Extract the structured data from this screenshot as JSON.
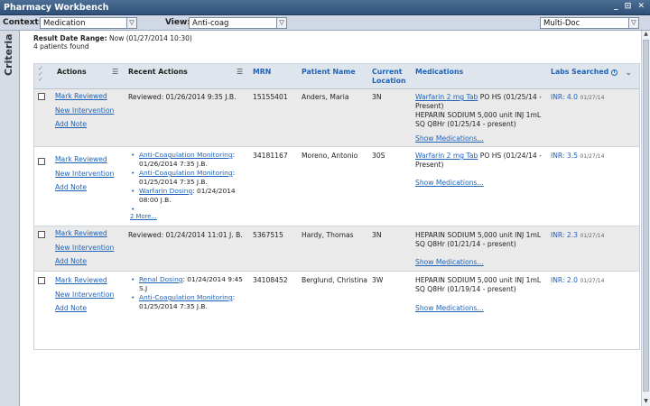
{
  "window": {
    "title": "Pharmacy Workbench",
    "controls": [
      "_",
      "⊡",
      "✕"
    ]
  },
  "toolbar": {
    "context_label": "Context:",
    "context_value": "Medication",
    "view_label": "View:",
    "view_value": "Anti-coag",
    "multi_value": "Multi-Doc"
  },
  "sidebar": {
    "criteria_label": "Criteria"
  },
  "meta": {
    "range_label": "Result Date Range:",
    "range_value": "Now (01/27/2014 10:30)",
    "patients_found": "4 patients found"
  },
  "table": {
    "headers": {
      "actions": "Actions",
      "recent": "Recent Actions",
      "mrn": "MRN",
      "patient": "Patient Name",
      "location": "Current Location",
      "meds": "Medications",
      "labs": "Labs Searched"
    },
    "rows": [
      {
        "actions": [
          "Mark Reviewed",
          "New Intervention",
          "Add Note"
        ],
        "recent_text": "Reviewed: 01/26/2014 9:35   J.B.",
        "mrn": "15155401",
        "patient": "Anders, Maria",
        "location": "3N",
        "med_link": "Warfarin 2 mg Tab",
        "med_rest": " PO HS (01/25/14 - Present)",
        "med_line2": "HEPARIN SODIUM 5,000 unit INJ 1mL SQ Q8Hr (01/25/14 - present)",
        "show_meds": "Show Medications...",
        "lab_value": "INR: 4.0",
        "lab_date": "01/27/14"
      },
      {
        "actions": [
          "Mark Reviewed",
          "New Intervention",
          "Add Note"
        ],
        "recent_items": [
          {
            "link": "Anti-Coagulation Monitoring",
            "rest": ": 01/26/2014 7:35  J.B."
          },
          {
            "link": "Anti-Coagulation Monitoring",
            "rest": ": 01/25/2014 7:35  J.B."
          },
          {
            "link": "Warfarin Dosing",
            "rest": ": 01/24/2014 08:00  J.B."
          },
          {
            "link": "",
            "rest": ""
          }
        ],
        "recent_more": "2 More...",
        "mrn": "34181167",
        "patient": "Moreno, Antonio",
        "location": "30S",
        "med_link": "Warfarin 2 mg Tab",
        "med_rest": " PO HS (01/24/14 - Present)",
        "show_meds": "Show Medications...",
        "lab_value": "INR: 3.5",
        "lab_date": "01/27/14"
      },
      {
        "actions": [
          "Mark Reviewed",
          "New Intervention",
          "Add Note"
        ],
        "recent_text": "Reviewed: 01/24/2014 11:01   J. B.",
        "mrn": "5367515",
        "patient": "Hardy, Thomas",
        "location": "3N",
        "med_line1": "HEPARIN SODIUM 5,000 unit INJ 1mL SQ Q8Hr (01/21/14 - present)",
        "show_meds": "Show Medications...",
        "lab_value": "INR: 2.3",
        "lab_date": "01/27/14"
      },
      {
        "actions": [
          "Mark Reviewed",
          "New Intervention",
          "Add Note"
        ],
        "recent_items": [
          {
            "link": "Renal Dosing",
            "rest": ": 01/24/2014 9:45 S.J"
          },
          {
            "link": "Anti-Coagulation Monitoring",
            "rest": ": 01/25/2014 7:35  J.B."
          }
        ],
        "mrn": "34108452",
        "patient": "Berglund, Christina",
        "location": "3W",
        "med_line1": "HEPARIN SODIUM 5,000 unit INJ 1mL SQ Q8Hr (01/19/14 - present)",
        "show_meds": "Show Medications...",
        "lab_value": "INR: 2.0",
        "lab_date": "01/27/14"
      }
    ]
  }
}
